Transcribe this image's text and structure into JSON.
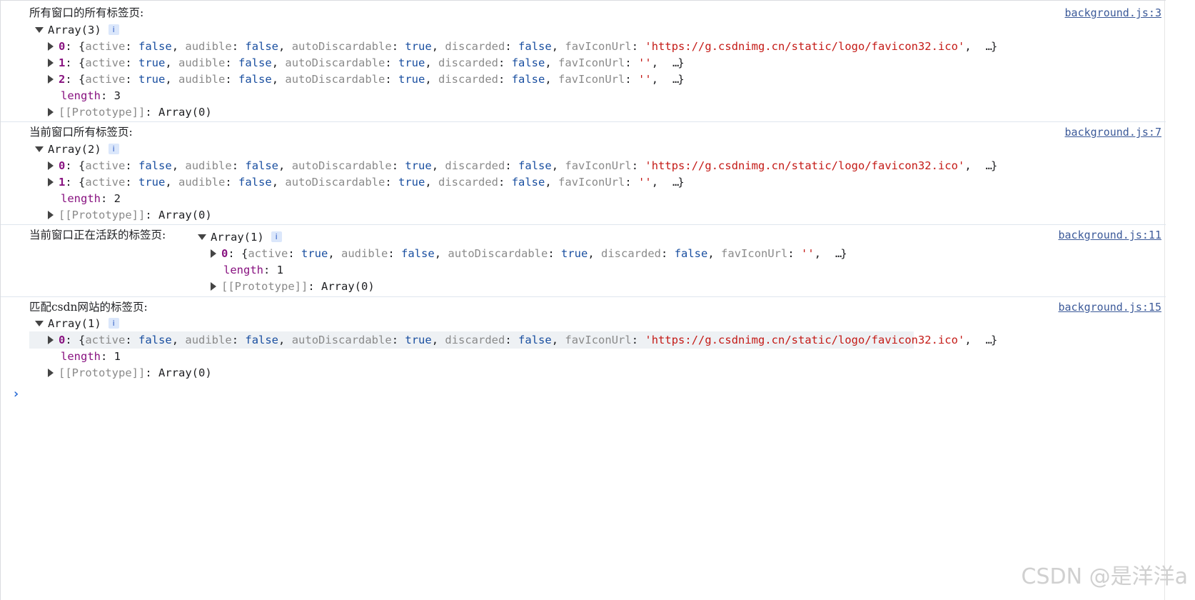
{
  "messages": [
    {
      "label": "所有窗口的所有标签页:",
      "source": "background.js:3",
      "array_label": "Array(3)",
      "items": [
        {
          "idx": "0",
          "active": "false",
          "audible": "false",
          "autoDiscardable": "true",
          "discarded": "false",
          "favIconUrl": "'https://g.csdnimg.cn/static/logo/favicon32.ico'"
        },
        {
          "idx": "1",
          "active": "true",
          "audible": "false",
          "autoDiscardable": "true",
          "discarded": "false",
          "favIconUrl": "''"
        },
        {
          "idx": "2",
          "active": "true",
          "audible": "false",
          "autoDiscardable": "true",
          "discarded": "false",
          "favIconUrl": "''"
        }
      ],
      "length": "3",
      "proto": "Array(0)"
    },
    {
      "label": "当前窗口所有标签页:",
      "source": "background.js:7",
      "array_label": "Array(2)",
      "items": [
        {
          "idx": "0",
          "active": "false",
          "audible": "false",
          "autoDiscardable": "true",
          "discarded": "false",
          "favIconUrl": "'https://g.csdnimg.cn/static/logo/favicon32.ico'"
        },
        {
          "idx": "1",
          "active": "true",
          "audible": "false",
          "autoDiscardable": "true",
          "discarded": "false",
          "favIconUrl": "''"
        }
      ],
      "length": "2",
      "proto": "Array(0)"
    },
    {
      "label": "当前窗口正在活跃的标签页:",
      "source": "background.js:11",
      "array_label": "Array(1)",
      "items": [
        {
          "idx": "0",
          "active": "true",
          "audible": "false",
          "autoDiscardable": "true",
          "discarded": "false",
          "favIconUrl": "''"
        }
      ],
      "length": "1",
      "proto": "Array(0)"
    },
    {
      "label": "匹配csdn网站的标签页:",
      "source": "background.js:15",
      "array_label": "Array(1)",
      "items": [
        {
          "idx": "0",
          "active": "false",
          "audible": "false",
          "autoDiscardable": "true",
          "discarded": "false",
          "favIconUrl": "'https://g.csdnimg.cn/static/logo/favicon32.ico'"
        }
      ],
      "length": "1",
      "proto": "Array(0)"
    }
  ],
  "keys": {
    "active": "active",
    "audible": "audible",
    "autoDiscardable": "autoDiscardable",
    "discarded": "discarded",
    "favIconUrl": "favIconUrl",
    "length": "length",
    "prototype": "[[Prototype]]"
  },
  "badge_text": "i",
  "ellipsis": "…",
  "watermark": "CSDN @是洋洋a",
  "colors": {
    "key": "#881280",
    "bool": "#1a4fa0",
    "string": "#c41a16",
    "link": "#3c5a99",
    "prompt": "#2b6cd6"
  }
}
